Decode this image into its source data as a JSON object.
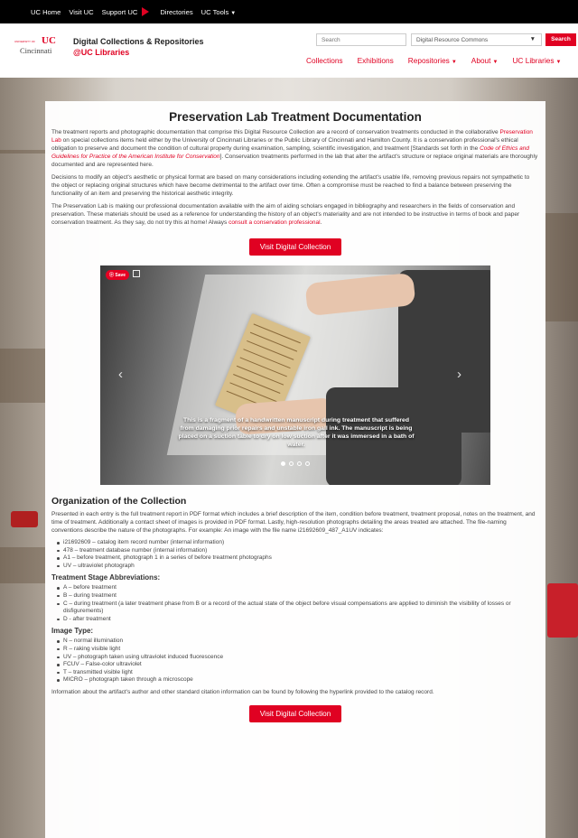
{
  "topbar": {
    "links": [
      "UC Home",
      "Visit UC",
      "Support UC",
      "Directories",
      "UC Tools"
    ]
  },
  "header": {
    "logo_small": "UNIVERSITY OF",
    "logo_name": "Cincinnati",
    "title": "Digital Collections & Repositories",
    "subtitle": "@UC Libraries",
    "search_placeholder": "Search",
    "collection_select": "Digital Resource Commons",
    "search_button": "Search",
    "nav": [
      "Collections",
      "Exhibitions",
      "Repositories",
      "About",
      "UC Libraries"
    ]
  },
  "colors": {
    "accent": "#e00122",
    "topbar": "#000000"
  },
  "main": {
    "title": "Preservation Lab Treatment Documentation",
    "intro": {
      "p1_a": "The treatment reports and photographic documentation that comprise this Digital Resource Collection are a record of conservation treatments conducted in the collaborative ",
      "p1_link": "Preservation Lab",
      "p1_b": " on special collections items held either by the University of Cincinnati Libraries or the Public Library of Cincinnati and Hamilton County. It is a conservation professional's ethical obligation to preserve and document the condition of cultural property during examination, sampling, scientific investigation, and treatment [Standards set forth in the ",
      "p1_link2": "Code of Ethics and Guidelines for Practice of the American Institute for Conservation",
      "p1_c": "]. Conservation treatments performed in the lab that alter the artifact's structure or replace original materials are thoroughly documented and are represented here.",
      "p2": "Decisions to modify an object's aesthetic or physical format are based on many considerations including extending the artifact's usable life, removing previous repairs not sympathetic to the object or replacing original structures which have become detrimental to the artifact over time. Often a compromise must be reached to find a balance between preserving the functionality of an item and preserving the historical aesthetic integrity.",
      "p3_a": "The Preservation Lab is making our professional documentation available with the aim of aiding scholars engaged in bibliography and researchers in the fields of conservation and preservation. These materials should be used as a reference for understanding the history of an object's materiality and are not intended to be instructive in terms of book and paper conservation treatment. As they say, do not try this at home! Always ",
      "p3_link": "consult a conservation professional",
      "p3_b": "."
    },
    "visit_button": "Visit Digital Collection",
    "carousel": {
      "save_label": "Save",
      "caption": "This is a fragment of a handwritten manuscript during treatment that suffered from damaging prior repairs and unstable iron gall ink. The manuscript is being placed on a suction table to dry on low suction after it was immersed in a bath of water.",
      "prev": "‹",
      "next": "›"
    },
    "organization": {
      "heading": "Organization of the Collection",
      "body": "Presented in each entry is the full treatment report in PDF format which includes a brief description of the item, condition before treatment, treatment proposal, notes on the treatment, and time of treatment. Additionally a contact sheet of images is provided in PDF format. Lastly, high-resolution photographs detailing the areas treated are attached. The file-naming conventions describe the nature of the photographs. For example: An image with the file name i21692609_487_A1UV indicates:",
      "file_items": [
        "i21692609 – catalog item record number (internal information)",
        "478 – treatment database number (internal information)",
        "A1 – before treatment, photograph 1 in a series of before treatment photographs",
        "UV – ultraviolet photograph"
      ],
      "stage_heading": "Treatment Stage Abbreviations:",
      "stage_items": [
        "A – before treatment",
        "B – during treatment",
        "C – during treatment (a later treatment phase from B or a record of the actual state of the object before visual compensations are applied to diminish the visibility of losses or disfigurements)",
        "D - after treatment"
      ],
      "image_heading": "Image Type:",
      "image_items": [
        "N – normal illumination",
        "R – raking visible light",
        "UV – photograph taken using ultraviolet induced fluorescence",
        "FCUV – False-color ultraviolet",
        "T – transmitted visible light",
        "MICRO – photograph taken through a microscope"
      ],
      "footer": "Information about the artifact's author and other standard citation information can be found by following the hyperlink provided to the catalog record."
    }
  }
}
